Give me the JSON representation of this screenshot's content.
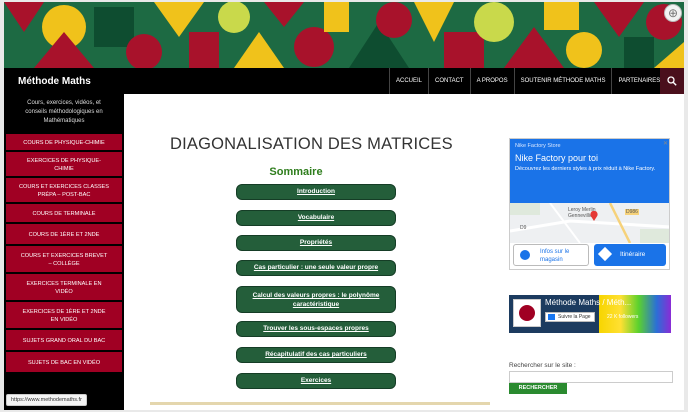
{
  "site": {
    "title": "Méthode Maths",
    "tagline": "Cours, exercices, vidéos, et conseils méthodologiques en Mathématiques"
  },
  "nav": {
    "items": [
      "ACCUEIL",
      "CONTACT",
      "A PROPOS",
      "SOUTENIR MÉTHODE MATHS",
      "PARTENAIRES"
    ]
  },
  "sidebar": {
    "items": [
      [
        "COURS DE PHYSIQUE-CHIMIE"
      ],
      [
        "EXERCICES DE PHYSIQUE-",
        "CHIMIE"
      ],
      [
        "COURS ET EXERCICES CLASSES",
        "PRÉPA – POST-BAC"
      ],
      [
        "COURS DE TERMINALE"
      ],
      [
        "COURS DE 1ÈRE ET 2NDE"
      ],
      [
        "COURS ET EXERCICES BREVET",
        "– COLLÈGE"
      ],
      [
        "EXERCICES TERMINALE EN",
        "VIDÉO"
      ],
      [
        "EXERCICES DE 1ÈRE ET 2NDE",
        "EN VIDÉO"
      ],
      [
        "SUJETS GRAND ORAL DU BAC"
      ],
      [
        "SUJETS DE BAC EN VIDÉO"
      ]
    ]
  },
  "main": {
    "title": "DIAGONALISATION DES MATRICES",
    "sommaire": "Sommaire",
    "toc": [
      [
        "Introduction"
      ],
      [
        "Vocabulaire"
      ],
      [
        "Propriétés"
      ],
      [
        "Cas particulier : une seule valeur propre"
      ],
      [
        "Calcul des valeurs propres : le polynôme",
        "caractéristique"
      ],
      [
        "Trouver les sous-espaces propres"
      ],
      [
        "Récapitulatif des cas particuliers"
      ],
      [
        "Exercices"
      ]
    ]
  },
  "ad": {
    "store": "Nike Factory Store",
    "headline": "Nike Factory pour toi",
    "description": "Découvrez les derniers styles à prix réduit à Nike Factory.",
    "map_labels": [
      "Leroy Merlin",
      "Gennevilliers",
      "D986",
      "D9"
    ],
    "info_label": [
      "Infos sur le",
      "magasin"
    ],
    "route_label": "Itinéraire",
    "close": "✕"
  },
  "facebook": {
    "page_name": "Méthode Maths / Méth...",
    "like_label": "Suivre la Page",
    "followers": "22 K followers"
  },
  "search": {
    "label": "Rechercher sur le site :",
    "button": "RECHERCHER",
    "value": ""
  },
  "status": {
    "url": "https://www.methodemaths.fr"
  },
  "colors": {
    "accent": "#a00023",
    "toc_green": "#245e3a",
    "title_green": "#2e7d1c",
    "ad_blue": "#1a73e8"
  }
}
